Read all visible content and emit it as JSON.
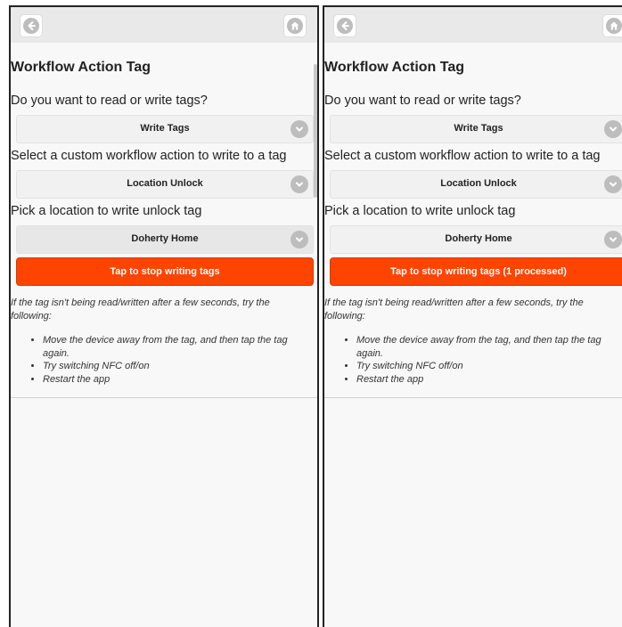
{
  "screens": [
    {
      "title": "Workflow Action Tag",
      "q1_label": "Do you want to read or write tags?",
      "q1_value": "Write Tags",
      "q2_label": "Select a custom workflow action to write to a tag",
      "q2_value": "Location Unlock",
      "q3_label": "Pick a location to write unlock tag",
      "q3_value": "Doherty Home",
      "action_label": "Tap to stop writing tags",
      "help_text": "If the tag isn't being read/written after a few seconds, try the following:",
      "help_items": [
        "Move the device away from the tag, and then tap the tag again.",
        "Try switching NFC off/on",
        "Restart the app"
      ]
    },
    {
      "title": "Workflow Action Tag",
      "q1_label": "Do you want to read or write tags?",
      "q1_value": "Write Tags",
      "q2_label": "Select a custom workflow action to write to a tag",
      "q2_value": "Location Unlock",
      "q3_label": "Pick a location to write unlock tag",
      "q3_value": "Doherty Home",
      "action_label": "Tap to stop writing tags (1 processed)",
      "help_text": "If the tag isn't being read/written after a few seconds, try the following:",
      "help_items": [
        "Move the device away from the tag, and then tap the tag again.",
        "Try switching NFC off/on",
        "Restart the app"
      ]
    }
  ],
  "icons": {
    "back": "arrow-left-circle-icon",
    "home": "home-icon",
    "dropdown": "chevron-down-circle-icon"
  },
  "colors": {
    "accent": "#ff4400",
    "background": "#f8f8f8",
    "toolbar": "#e9e9e9"
  }
}
